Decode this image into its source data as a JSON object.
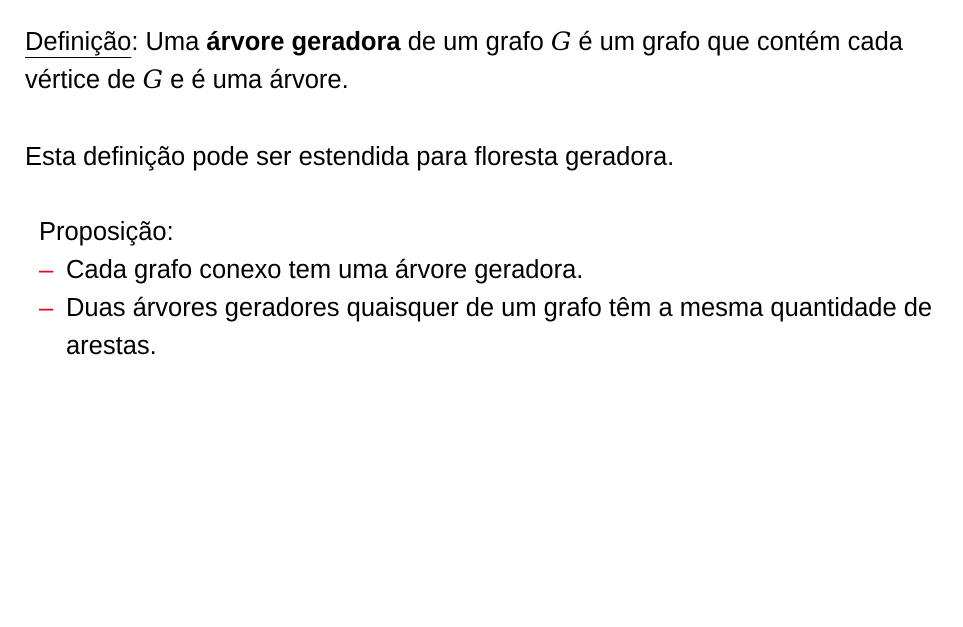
{
  "definition": {
    "label": "Definição",
    "colon": ":",
    "text_1": " Uma ",
    "term": "árvore geradora",
    "text_2": " de um grafo ",
    "var_1": "G",
    "text_3": " é um grafo que contém cada vértice de ",
    "var_2": "G",
    "text_4": " e é uma árvore."
  },
  "extension": {
    "text": "Esta definição pode ser estendida para floresta geradora."
  },
  "proposition": {
    "title": "Proposição:",
    "bullet": "–",
    "items": [
      "Cada grafo conexo tem uma árvore geradora.",
      "Duas árvores geradores quaisquer de um grafo têm a mesma quantidade de arestas."
    ]
  },
  "colors": {
    "text": "#000000",
    "bullet": "#e8001b",
    "background": "#ffffff"
  }
}
